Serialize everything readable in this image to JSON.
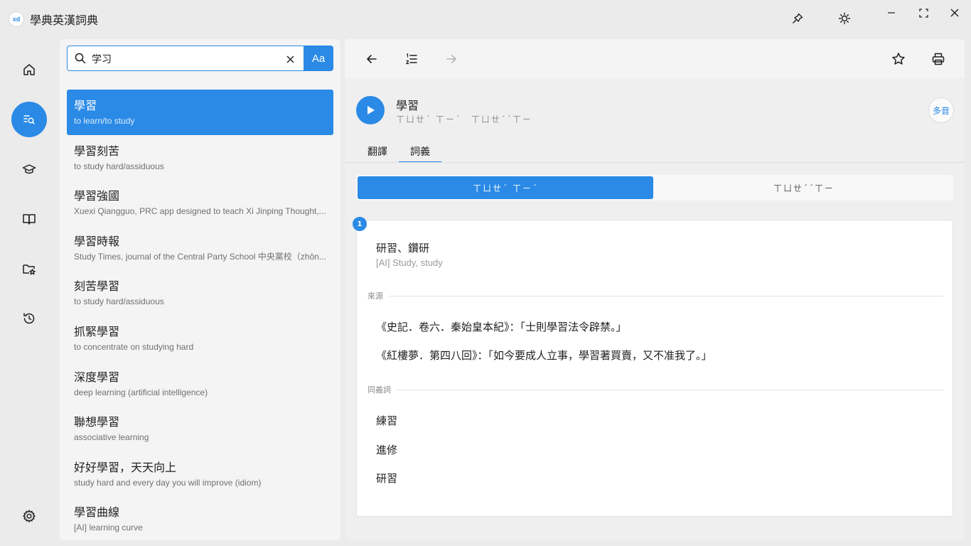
{
  "app": {
    "logo_text": "xd",
    "title": "學典英漢詞典"
  },
  "search": {
    "value": "学习",
    "aa_label": "Aa"
  },
  "results": [
    {
      "headword": "學習",
      "gloss": "to learn/to study",
      "selected": true
    },
    {
      "headword": "學習刻苦",
      "gloss": "to study hard/assiduous"
    },
    {
      "headword": "學習強國",
      "gloss": "Xuexi Qiangguo, PRC app designed to teach Xi Jinping Thought,..."
    },
    {
      "headword": "學習時報",
      "gloss": "Study Times, journal of the Central Party School 中央黨校（zhōn..."
    },
    {
      "headword": "刻苦學習",
      "gloss": "to study hard/assiduous"
    },
    {
      "headword": "抓緊學習",
      "gloss": "to concentrate on studying hard"
    },
    {
      "headword": "深度學習",
      "gloss": "deep learning (artificial intelligence)"
    },
    {
      "headword": "聯想學習",
      "gloss": "associative learning"
    },
    {
      "headword": "好好學習，天天向上",
      "gloss": "study hard and every day you will improve (idiom)"
    },
    {
      "headword": "學習曲線",
      "gloss": "[AI] learning curve"
    }
  ],
  "detail": {
    "word": "學習",
    "bopomofo": "ㄒㄩㄝˊ ㄒㄧˊ　ㄒㄩㄝˊˊㄒㄧ",
    "duoyin": "多音",
    "tabs": [
      "翻譯",
      "詞義"
    ],
    "readings": [
      "ㄒㄩㄝˊ ㄒㄧˊ",
      "ㄒㄩㄝˊˊㄒㄧ"
    ],
    "definition": {
      "number": "1",
      "text": "研習、鑽研",
      "translation": "[AI] Study, study",
      "source_label": "來源",
      "sources": [
        "《史記．卷六．秦始皇本紀》：「士則學習法令辟禁。」",
        "《紅樓夢．第四八回》：「如今要成人立事，學習著買賣，又不准我了。」"
      ],
      "synonym_label": "同義詞",
      "synonyms": [
        "練習",
        "進修",
        "研習"
      ]
    }
  },
  "colors": {
    "accent": "#2a8ae6",
    "background": "#ebebeb",
    "panel": "#f4f4f4"
  }
}
